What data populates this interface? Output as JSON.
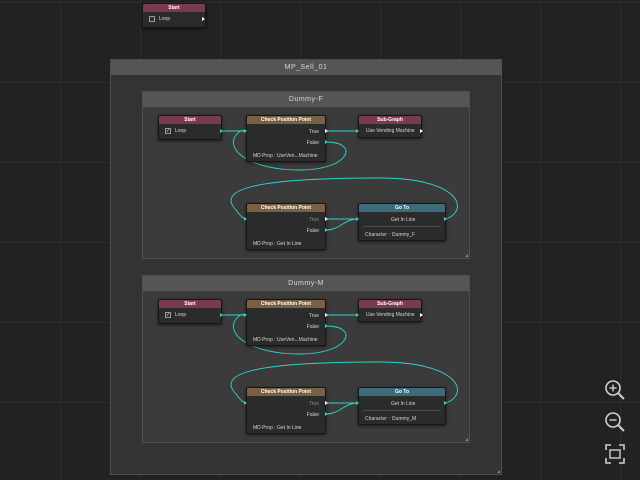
{
  "top_node": {
    "header": "Start",
    "loop_label": "Loop",
    "loop_checked": false
  },
  "outer_group": {
    "title": "MP_Sell_01"
  },
  "subgroups": [
    {
      "title": "Dummy-F",
      "start": {
        "header": "Start",
        "loop_label": "Loop",
        "loop_checked": true
      },
      "check1": {
        "header": "Check Position Point",
        "true_label": "True",
        "false_label": "False",
        "prop_label": "MD Prop :",
        "prop_value": "UseVen...Machine"
      },
      "subgraph": {
        "header": "Sub-Graph",
        "value": "Use Vending Machine"
      },
      "check2": {
        "header": "Check Position Point",
        "true_label": "True",
        "false_label": "False",
        "prop_label": "MD Prop :",
        "prop_value": "Get In Line"
      },
      "goto": {
        "header": "Go To",
        "value": "Get In Line",
        "char_label": "Character :",
        "char_value": "Dummy_F"
      }
    },
    {
      "title": "Dummy-M",
      "start": {
        "header": "Start",
        "loop_label": "Loop",
        "loop_checked": true
      },
      "check1": {
        "header": "Check Position Point",
        "true_label": "True",
        "false_label": "False",
        "prop_label": "MD Prop :",
        "prop_value": "UseVen...Machine"
      },
      "subgraph": {
        "header": "Sub-Graph",
        "value": "Use Vending Machine"
      },
      "check2": {
        "header": "Check Position Point",
        "true_label": "True",
        "false_label": "False",
        "prop_label": "MD Prop :",
        "prop_value": "Get In Line"
      },
      "goto": {
        "header": "Go To",
        "value": "Get In Line",
        "char_label": "Character :",
        "char_value": "Dummy_M"
      }
    }
  ],
  "controls": {
    "zoom_in_icon": "zoom-in-icon",
    "zoom_out_icon": "zoom-out-icon",
    "fit_icon": "fit-to-screen-icon"
  },
  "colors": {
    "canvas": "#222222",
    "start_header": "#7a3a50",
    "check_header": "#7a6040",
    "goto_header": "#3c6b7a",
    "wire": "#2fd4c8"
  }
}
